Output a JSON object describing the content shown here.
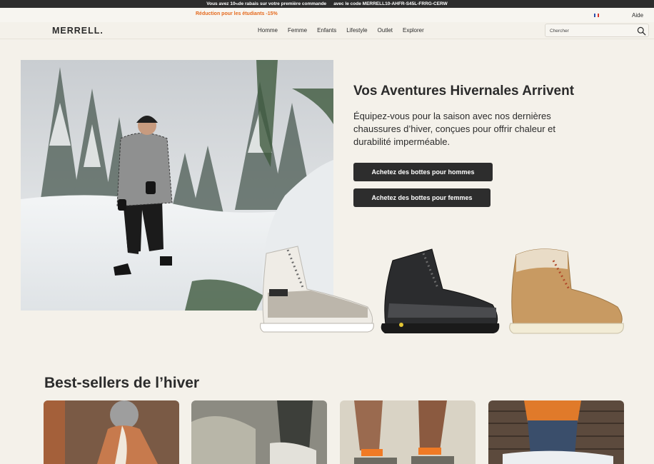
{
  "announcement": {
    "lead": "Vous avez 10",
    "sup": "%",
    "middle": " de rabais sur votre première commande",
    "code_prefix": "avec le code",
    "code": "MERRELL10-AHFR-S45L-FRRG-CERW"
  },
  "promo": {
    "text": "Réduction pour les étudiants -15%",
    "help": "Aide"
  },
  "header": {
    "logo": "MERRELL.",
    "nav": [
      "Homme",
      "Femme",
      "Enfants",
      "Lifestyle",
      "Outlet",
      "Explorer"
    ],
    "search_placeholder": "Chercher",
    "search_icon": "search-icon"
  },
  "hero": {
    "title": "Vos Aventures Hivernales Arrivent",
    "subtitle": "Équipez-vous pour la saison avec nos dernières chaussures d’hiver, conçues pour offrir chaleur et durabilité imperméable.",
    "cta_men": "Achetez des bottes pour hommes",
    "cta_women": "Achetez des bottes pour femmes"
  },
  "bestsellers": {
    "title": "Best-sellers de l’hiver"
  },
  "colors": {
    "background": "#f4f1ea",
    "dark": "#2d2d2d",
    "accent": "#e56a1e"
  }
}
